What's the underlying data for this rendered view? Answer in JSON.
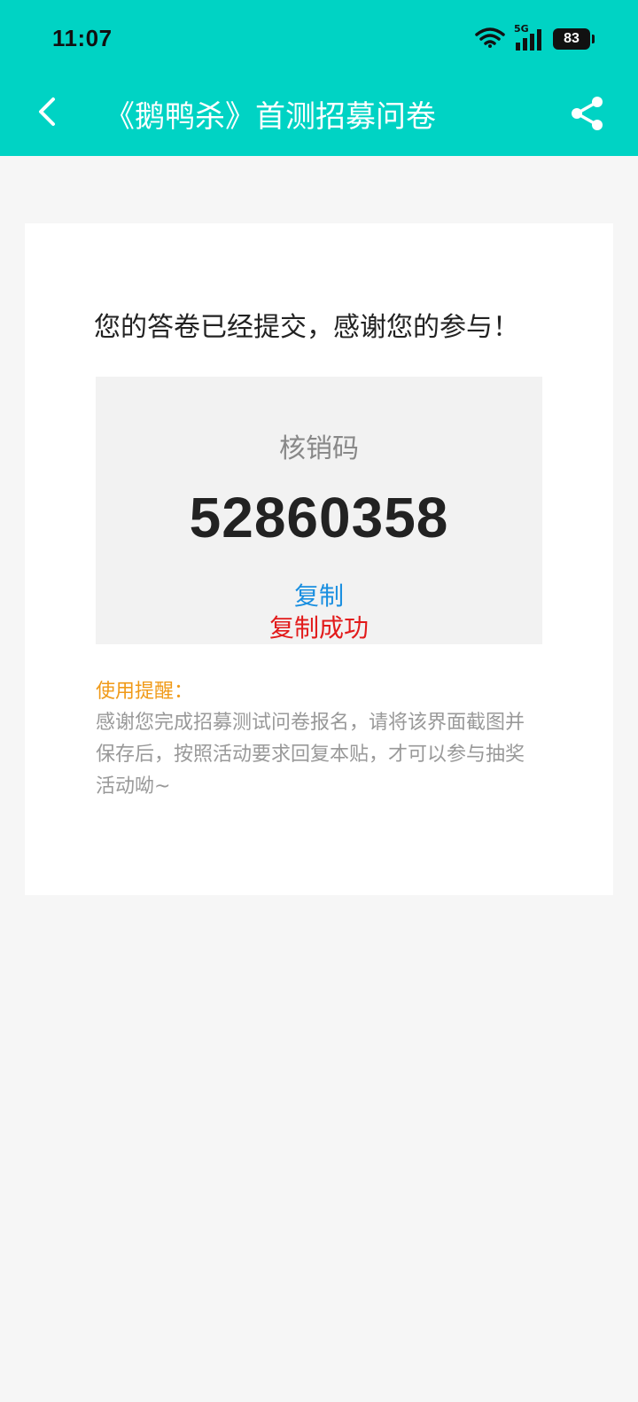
{
  "status_bar": {
    "time": "11:07",
    "network": "5G",
    "battery": "83"
  },
  "nav": {
    "title": "《鹅鸭杀》首测招募问卷"
  },
  "card": {
    "thanks": "您的答卷已经提交，感谢您的参与！",
    "code_label": "核销码",
    "code_value": "52860358",
    "copy_label": "复制",
    "copy_success": "复制成功",
    "reminder_title": "使用提醒：",
    "reminder_text": "感谢您完成招募测试问卷报名，请将该界面截图并保存后，按照活动要求回复本贴，才可以参与抽奖活动呦~"
  },
  "colors": {
    "header": "#00d3c4",
    "copy": "#1a8fe0",
    "success": "#e21b1b",
    "reminder": "#f09a18"
  }
}
